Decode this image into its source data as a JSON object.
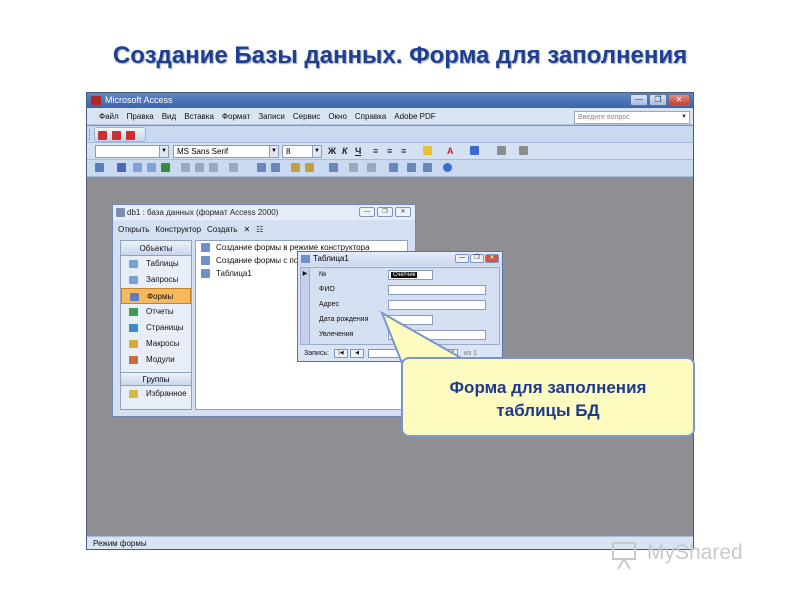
{
  "slide": {
    "title": "Создание Базы данных. Форма для заполнения"
  },
  "app": {
    "title": "Microsoft Access",
    "menu": [
      "Файл",
      "Правка",
      "Вид",
      "Вставка",
      "Формат",
      "Записи",
      "Сервис",
      "Окно",
      "Справка",
      "Adobe PDF"
    ],
    "help_placeholder": "Введите вопрос",
    "font_name": "MS Sans Serif",
    "font_size": "8",
    "status": "Режим формы"
  },
  "db_window": {
    "title": "db1 : база данных (формат Access 2000)",
    "toolbar": [
      "Открыть",
      "Конструктор",
      "Создать"
    ],
    "objects_header": "Объекты",
    "objects": [
      "Таблицы",
      "Запросы",
      "Формы",
      "Отчеты",
      "Страницы",
      "Макросы",
      "Модули"
    ],
    "selected_object": "Формы",
    "groups_header": "Группы",
    "groups": [
      "Избранное"
    ],
    "list": [
      "Создание формы в режиме конструктора",
      "Создание формы с помощью мастера",
      "Таблица1"
    ]
  },
  "form_window": {
    "title": "Таблица1",
    "fields": [
      {
        "label": "№",
        "value": "Счетчик"
      },
      {
        "label": "ФИО",
        "value": ""
      },
      {
        "label": "Адрес",
        "value": ""
      },
      {
        "label": "Дата рождения",
        "value": ""
      },
      {
        "label": "Увлечения",
        "value": ""
      }
    ],
    "record_label": "Запись:",
    "record_number": "1",
    "record_total": "из 1"
  },
  "callout": {
    "line1": "Форма для заполнения",
    "line2": "таблицы БД"
  },
  "watermark": {
    "text": "MyShared"
  },
  "colors": {
    "title": "#1f3f8f",
    "callout_bg": "#fdfbc0",
    "callout_border": "#7b95d1",
    "selected_object": "#f7b85b"
  }
}
